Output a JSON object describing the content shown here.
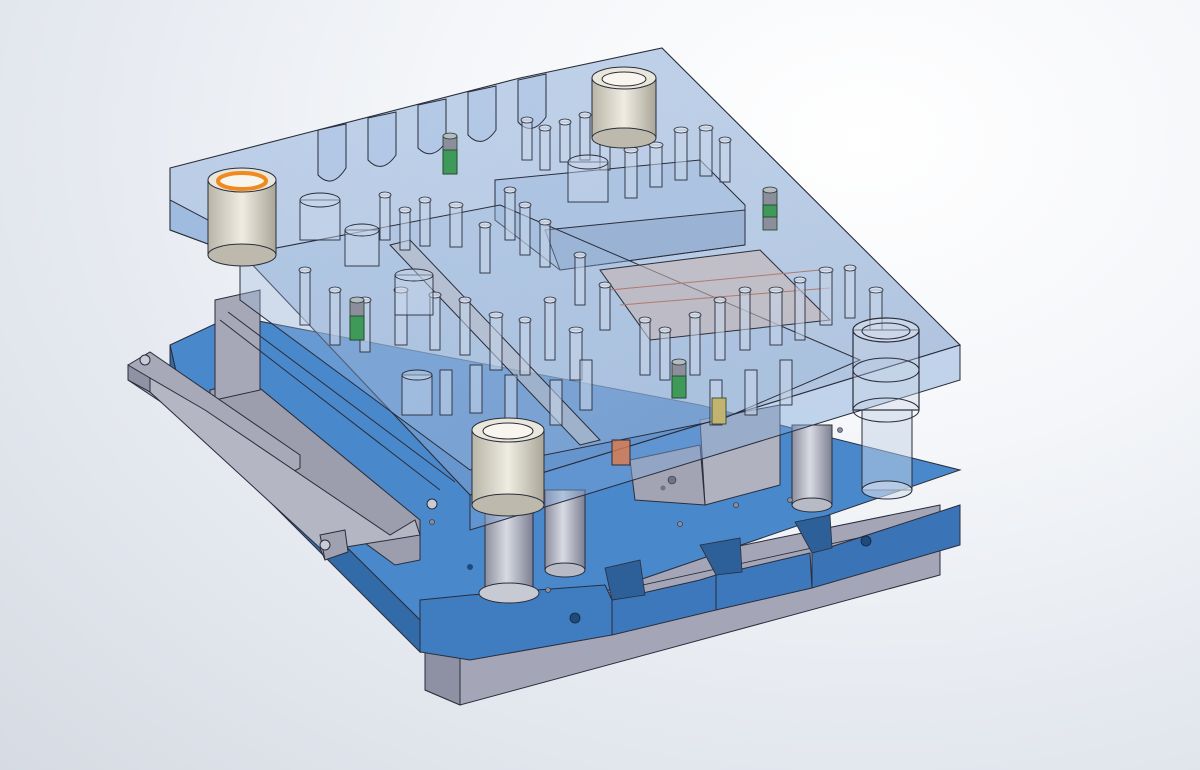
{
  "viewport": {
    "background_top": "#ffffff",
    "background_bottom": "#d6dbe3"
  },
  "colors": {
    "die_shoe_blue": "#3f7fc4",
    "die_shoe_blue_dark": "#2b5f9c",
    "steel_gray": "#a9abb9",
    "steel_gray_dark": "#7d8093",
    "transparent_plate": "#7fa6d6",
    "spring_green": "#3f9a5a",
    "highlight_orange": "#f08a1e",
    "edge": "#2a2d3a"
  },
  "model": {
    "name_icon": "cad-assembly-icon",
    "components": [
      "lower-die-shoe",
      "upper-die-shoe",
      "stripper-plate",
      "guide-post-front",
      "guide-post-left",
      "guide-post-right",
      "guide-post-back",
      "side-feed-rail",
      "punch-array",
      "nitrogen-springs"
    ]
  }
}
